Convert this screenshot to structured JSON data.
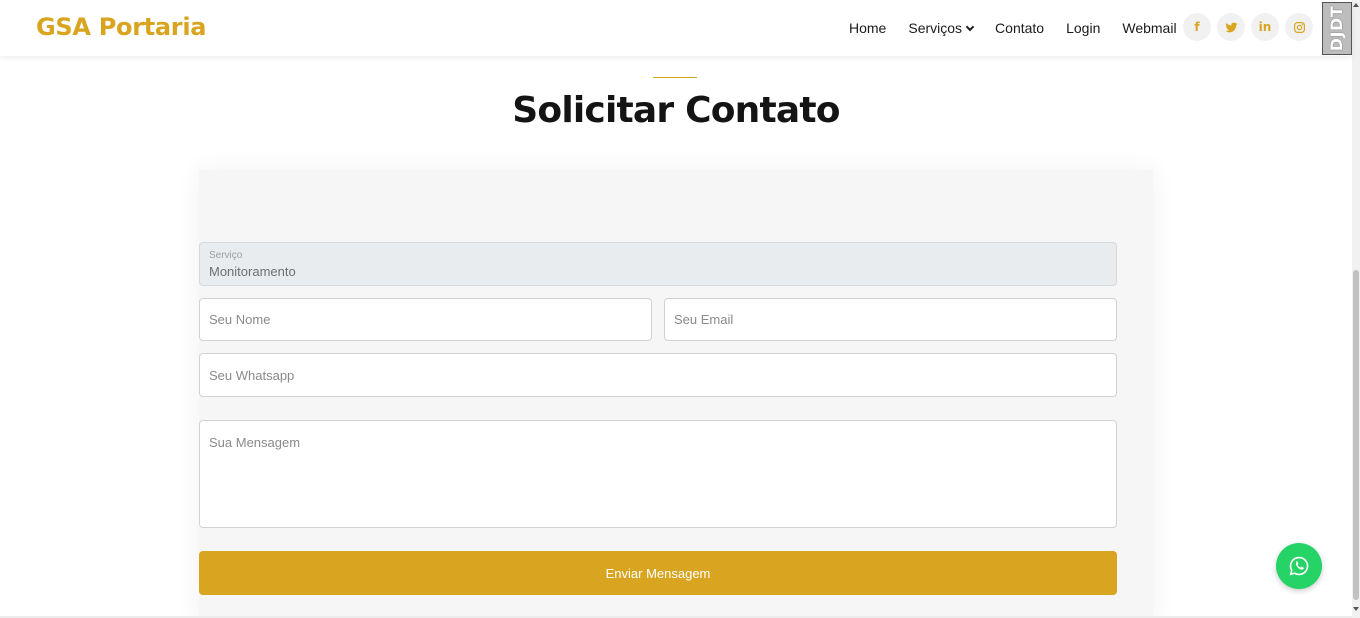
{
  "header": {
    "logo": "GSA Portaria",
    "nav": [
      {
        "label": "Home"
      },
      {
        "label": "Serviços",
        "has_dropdown": true
      },
      {
        "label": "Contato"
      },
      {
        "label": "Login"
      },
      {
        "label": "Webmail"
      }
    ],
    "socials": [
      {
        "name": "facebook-icon",
        "glyph": "f"
      },
      {
        "name": "twitter-icon",
        "glyph": ""
      },
      {
        "name": "linkedin-icon",
        "glyph": "in"
      },
      {
        "name": "instagram-icon",
        "glyph": ""
      }
    ]
  },
  "debug_badge": "DJDT",
  "section": {
    "title": "Solicitar Contato"
  },
  "form": {
    "service_label": "Serviço",
    "service_value": "Monitoramento",
    "name_placeholder": "Seu Nome",
    "email_placeholder": "Seu Email",
    "whatsapp_placeholder": "Seu Whatsapp",
    "message_placeholder": "Sua Mensagem",
    "submit_label": "Enviar Mensagem"
  },
  "colors": {
    "accent": "#d9a520",
    "whatsapp": "#25d366"
  }
}
